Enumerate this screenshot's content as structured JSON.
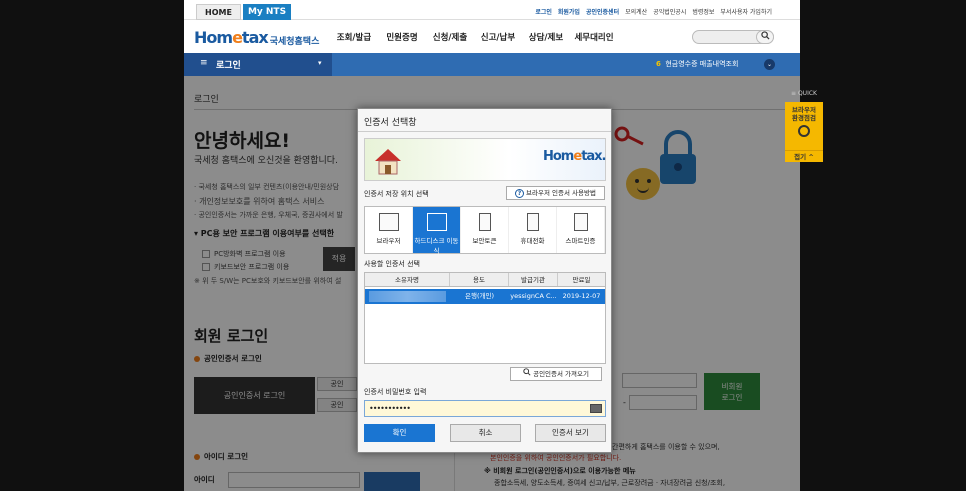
{
  "top": {
    "tab_home": "HOME",
    "tab_mynts": "My NTS",
    "links": [
      "로그인",
      "회원가입",
      "공인인증센터",
      "모의계산",
      "공익법인공시",
      "범령정보",
      "부서사용자 가입하기"
    ]
  },
  "header": {
    "logo_text_1": "Hom",
    "logo_text_2": "e",
    "logo_text_3": "tax",
    "logo_kr": "국세청홈택스",
    "menu": [
      "조회/발급",
      "민원증명",
      "신청/제출",
      "신고/납부",
      "상담/제보",
      "세무대리인"
    ]
  },
  "bluebar": {
    "menu_label": "로그인",
    "hamburger": "≡",
    "dropdown": "▾",
    "notice_num": "6",
    "notice_text": "현금영수증 매출내역조회",
    "notice_chevron": "⌄"
  },
  "content": {
    "breadcrumb": "로그인",
    "hello": "안녕하세요!",
    "welcome": "국세청 홈택스에 오신것을 환영합니다.",
    "bullets": [
      "· 국세청 홈택스의 일부 컨텐츠(이용안내/민원상담",
      "· 개인정보보호를 위하여 홈택스 서비스",
      "· 공인인증서는 가까운 은행, 우체국, 증권사에서 발"
    ],
    "pc_section": "▾ PC용 보안 프로그램 이용여부를 선택한",
    "check1": "PC방화벽 프로그램 이용",
    "check2": "키보드보안 프로그램 이용",
    "apply": "적용",
    "note": "※ 위 두 S/W는 PC보호와 키보드보안를 위하여 설",
    "member_title": "회원 로그인",
    "cert_login_head": "공인인증서 로그인",
    "cert_login_btn": "공인인증서 로그인",
    "small_btn1": "공인",
    "small_btn2": "공인",
    "id_login_head": "아이디 로그인",
    "id_label": "아이디",
    "dash": "-",
    "nonmember_btn_1": "비회원",
    "nonmember_btn_2": "로그인",
    "rtext1": "간편하게 홈택스를 이용할 수 있으며,",
    "rtext2": "본인인증을 위하여 공인인증서가 필요합니다.",
    "rtext3": "※ 비회원 로그인(공인인증서)으로 이용가능한 메뉴",
    "rtext4": "종합소득세, 양도소득세, 증여세 신고/납부, 근로장려금 · 자녀장려금 신청/조회,"
  },
  "quick": {
    "label": "≡ QUICK",
    "box_line1": "브라우저",
    "box_line2": "환경점검",
    "close": "접기 ^"
  },
  "dialog": {
    "title": "인증서 선택창",
    "banner_logo_1": "Hom",
    "banner_logo_2": "e",
    "banner_logo_3": "tax.",
    "location_label": "인증서 저장 위치 선택",
    "help_icon": "?",
    "help_btn": "브라우저 인증서 사용방법",
    "locations": [
      {
        "label": "브라우저"
      },
      {
        "label": "하드디스크 이동식"
      },
      {
        "label": "보안토큰"
      },
      {
        "label": "휴대전화"
      },
      {
        "label": "스마트인증"
      }
    ],
    "cert_label": "사용할 인증서 선택",
    "columns": [
      "소유자명",
      "용도",
      "발급기관",
      "만료일"
    ],
    "row": {
      "usage": "은행(개인)",
      "issuer": "yessignCA C...",
      "expiry": "2019-12-07"
    },
    "import_btn": "공인인증서 가져오기",
    "pw_label": "인증서 비밀번호 입력",
    "pw_value": "•••••••••••",
    "ok": "확인",
    "cancel": "취소",
    "view": "인증서 보기"
  },
  "colors": {
    "brand_blue": "#1a5aa0",
    "accent_blue": "#1a75d2",
    "orange": "#f07f1b",
    "quick_yellow": "#f5b800",
    "green": "#2e8b3c"
  }
}
